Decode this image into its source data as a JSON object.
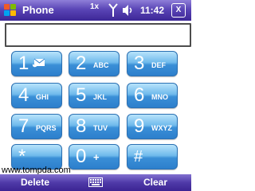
{
  "titlebar": {
    "title": "Phone",
    "status_icons": [
      "start-menu-icon",
      "connectivity-icon",
      "signal-icon",
      "speaker-icon"
    ],
    "connectivity_text": "1x",
    "clock": "11:42",
    "close_label": "X"
  },
  "display": {
    "value": ""
  },
  "keypad": {
    "keys": [
      {
        "digit": "1",
        "letters": "",
        "icon": "voicemail-icon"
      },
      {
        "digit": "2",
        "letters": "ABC"
      },
      {
        "digit": "3",
        "letters": "DEF"
      },
      {
        "digit": "4",
        "letters": "GHI"
      },
      {
        "digit": "5",
        "letters": "JKL"
      },
      {
        "digit": "6",
        "letters": "MNO"
      },
      {
        "digit": "7",
        "letters": "PQRS"
      },
      {
        "digit": "8",
        "letters": "TUV"
      },
      {
        "digit": "9",
        "letters": "WXYZ"
      },
      {
        "digit": "*",
        "letters": ""
      },
      {
        "digit": "0",
        "letters": "+"
      },
      {
        "digit": "#",
        "letters": ""
      }
    ]
  },
  "watermark": "www.tompda.com",
  "softkeys": {
    "left": "Delete",
    "right": "Clear",
    "center_icon": "keyboard-icon"
  },
  "colors": {
    "title_bar": "#5a45b6",
    "key_top": "#b8e3fb",
    "key_bottom": "#2d7fcc"
  }
}
